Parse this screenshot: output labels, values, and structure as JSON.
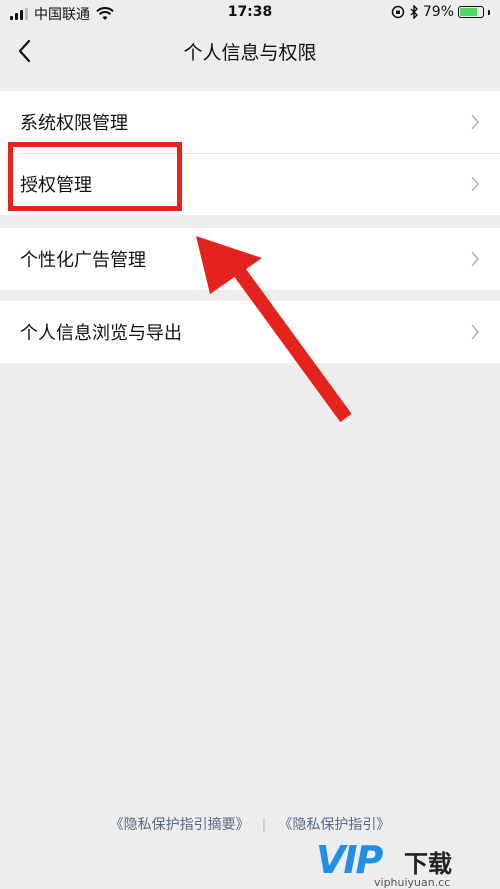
{
  "status": {
    "carrier": "中国联通",
    "time": "17:38",
    "battery": "79%",
    "battery_level": 0.79
  },
  "nav": {
    "title": "个人信息与权限"
  },
  "menu": [
    {
      "label": "系统权限管理"
    },
    {
      "label": "授权管理"
    },
    {
      "label": "个性化广告管理"
    },
    {
      "label": "个人信息浏览与导出"
    }
  ],
  "footer": {
    "link1": "《隐私保护指引摘要》",
    "separator": "|",
    "link2": "《隐私保护指引》"
  },
  "watermark": {
    "brand": "VIP",
    "suffix": "下载",
    "url": "viphuiyuan.cc"
  },
  "colors": {
    "background": "#ededed",
    "annotation": "#e3231c",
    "link": "#5a6a8c",
    "brand": "#1f8fe8"
  }
}
